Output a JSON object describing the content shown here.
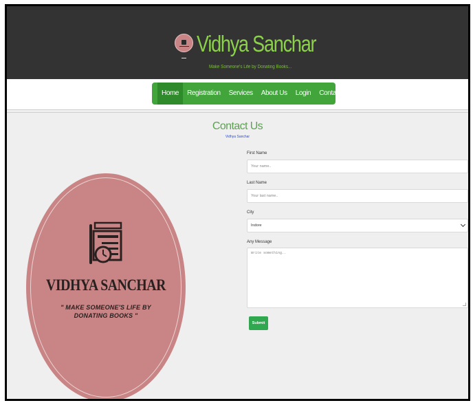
{
  "header": {
    "brand": "Vidhya Sanchar",
    "tagline": "Make Someone's Life by Donating Books..."
  },
  "nav": {
    "items": [
      {
        "label": "Home",
        "active": true
      },
      {
        "label": "Registration",
        "active": false
      },
      {
        "label": "Services",
        "active": false
      },
      {
        "label": "About Us",
        "active": false
      },
      {
        "label": "Login",
        "active": false
      },
      {
        "label": "Contact Us",
        "active": false
      }
    ]
  },
  "page": {
    "title": "Contact Us",
    "subtitle": "Vidhya Sanchar"
  },
  "logo": {
    "title": "VIDHYA SANCHAR",
    "tagline": "\" MAKE SOMEONE'S LIFE BY DONATING BOOKS \""
  },
  "form": {
    "first_name_label": "First Name",
    "first_name_placeholder": "Your name..",
    "last_name_label": "Last Name",
    "last_name_placeholder": "Your last name..",
    "city_label": "City",
    "city_value": "Indore",
    "message_label": "Any Message",
    "message_placeholder": "Write something..",
    "submit_label": "Submit"
  },
  "colors": {
    "header_bg": "#333333",
    "brand_green": "#8bd14a",
    "nav_green": "#41a53c",
    "logo_pink": "#c98585",
    "submit_green": "#2fa84f"
  }
}
